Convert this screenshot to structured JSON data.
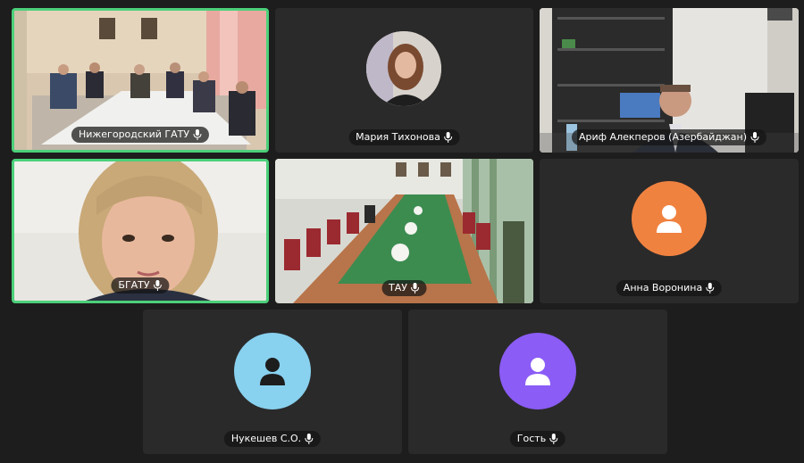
{
  "colors": {
    "background": "#1d1d1d",
    "tile": "#2a2a2a",
    "active_border": "#4cd07a",
    "avatar_orange": "#f08240",
    "avatar_lightblue": "#88d1ef",
    "avatar_purple": "#8b5cf6"
  },
  "participants": [
    {
      "name": "Нижегородский ГАТУ",
      "video": true,
      "active": true,
      "icon": "mic-icon"
    },
    {
      "name": "Мария Тихонова",
      "video": false,
      "photo_avatar": true,
      "icon": "mic-icon"
    },
    {
      "name": "Ариф Алекперов (Азербайджан)",
      "video": true,
      "icon": "mic-icon"
    },
    {
      "name": "БГАТУ",
      "video": true,
      "active": true,
      "icon": "mic-icon"
    },
    {
      "name": "ТАУ",
      "video": true,
      "icon": "mic-icon"
    },
    {
      "name": "Анна Воронина",
      "video": false,
      "avatar_color": "orange",
      "icon": "mic-icon"
    },
    {
      "name": "Нукешев С.О.",
      "video": false,
      "avatar_color": "lightblue",
      "icon": "mic-icon"
    },
    {
      "name": "Гость",
      "video": false,
      "avatar_color": "purple",
      "icon": "mic-icon"
    }
  ]
}
